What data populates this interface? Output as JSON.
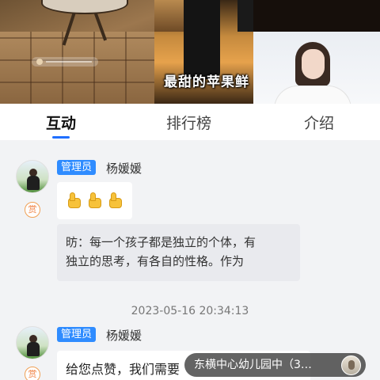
{
  "video": {
    "subtitle": "最甜的苹果鲜"
  },
  "tabs": [
    {
      "label": "互动",
      "active": true
    },
    {
      "label": "排行榜",
      "active": false
    },
    {
      "label": "介绍",
      "active": false
    }
  ],
  "accent_color": "#1f6fff",
  "chat": {
    "messages": [
      {
        "badge": "管理员",
        "sender": "杨媛媛",
        "reward_icon": "赏",
        "content": [
          "thumbs-up-emoji",
          "thumbs-up-emoji",
          "thumbs-up-emoji"
        ],
        "quote_lines": [
          "昉：每一个孩子都是独立的个体，有",
          "独立的思考，有各自的性格。作为"
        ]
      },
      {
        "timestamp": "2023-05-16 20:34:13"
      },
      {
        "badge": "管理员",
        "sender": "杨媛媛",
        "reward_icon": "赏",
        "text": "给您点赞，我们需要"
      }
    ]
  },
  "notice": {
    "text": "东横中心幼儿园中（3…"
  }
}
